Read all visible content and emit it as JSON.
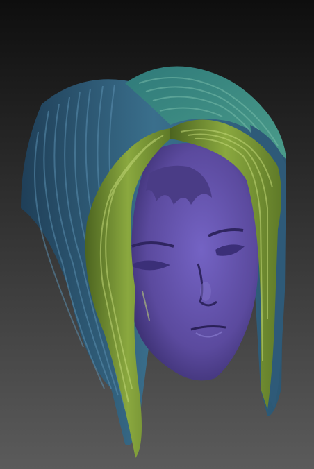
{
  "scene": {
    "subject": "sculpted-head-with-hair",
    "colors": {
      "background_top": "#0e0e0e",
      "background_bottom": "#5b5b5b",
      "face": "#5b4a9e",
      "face_shadow": "#2f2560",
      "face_highlight": "#8c7fd0",
      "hair_teal": "#3f8f86",
      "hair_blue": "#32607e",
      "hair_blue_dark": "#1f3f58",
      "hair_green": "#7b9a35",
      "hair_green_light": "#a9c35a",
      "hair_green_dark": "#4c6420"
    }
  }
}
